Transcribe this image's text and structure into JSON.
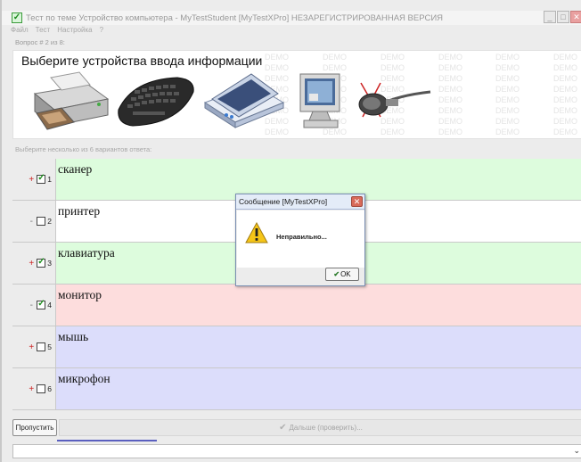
{
  "window": {
    "title": "Тест по теме Устройство компьютера - MyTestStudent [MyTestXPro] НЕЗАРЕГИСТРИРОВАННАЯ ВЕРСИЯ"
  },
  "menu": [
    "Файл",
    "Тест",
    "Настройка",
    "?"
  ],
  "question_number": "Вопрос # 2 из 8:",
  "question_text": "Выберите устройства ввода информации",
  "demo_watermark": "DEMO",
  "device_icons": [
    "printer-icon",
    "keyboard-icon",
    "scanner-icon",
    "monitor-icon",
    "microphone-icon"
  ],
  "instruction": "Выберите несколько из 6 вариантов ответа:",
  "answers": [
    {
      "mark": "+",
      "checked": true,
      "number": "1",
      "text": "сканер",
      "bg": "green"
    },
    {
      "mark": "-",
      "checked": false,
      "number": "2",
      "text": "принтер",
      "bg": "white"
    },
    {
      "mark": "+",
      "checked": true,
      "number": "3",
      "text": "клавиатура",
      "bg": "green"
    },
    {
      "mark": "-",
      "checked": true,
      "number": "4",
      "text": "монитор",
      "bg": "red"
    },
    {
      "mark": "+",
      "checked": false,
      "number": "5",
      "text": "мышь",
      "bg": "blue"
    },
    {
      "mark": "+",
      "checked": false,
      "number": "6",
      "text": "микрофон",
      "bg": "blue"
    }
  ],
  "buttons": {
    "skip": "Пропустить",
    "next": "Дальше (проверить)..."
  },
  "progress": {
    "fraction": 0.18
  },
  "dialog": {
    "title": "Сообщение [MyTestXPro]",
    "message": "Неправильно...",
    "ok": "OK"
  },
  "colors": {
    "green": "#ddfcdd",
    "white": "#ffffff",
    "red": "#fddddd",
    "blue": "#dcddfb",
    "progress": "#5a5fbf"
  }
}
